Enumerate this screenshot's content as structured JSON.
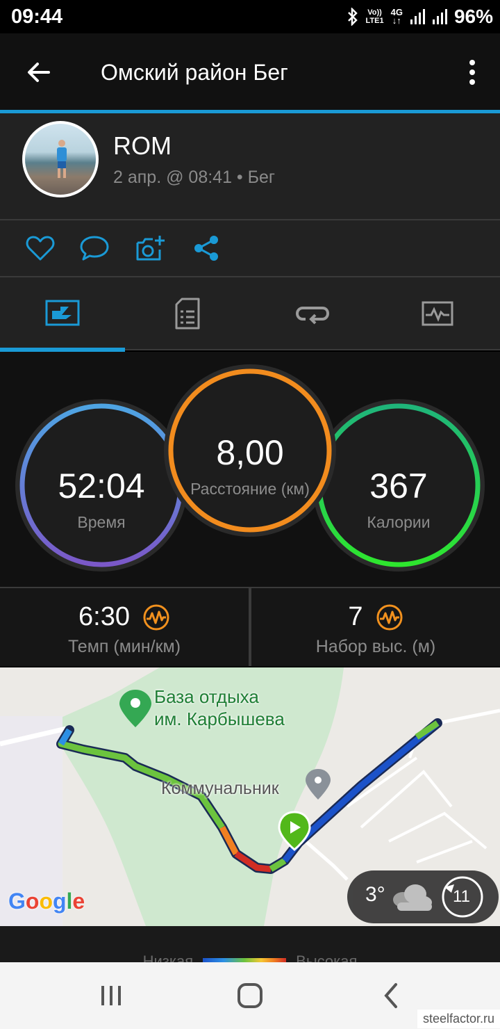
{
  "status_bar": {
    "time": "09:44",
    "network_line1": "Vo))",
    "network_line2": "LTE1",
    "network_type": "4G",
    "battery": "96%"
  },
  "header": {
    "title": "Омский район Бег"
  },
  "user": {
    "name": "ROM",
    "activity_info": "2 апр. @ 08:41 • Бег"
  },
  "summary": {
    "time_value": "52:04",
    "time_label": "Время",
    "distance_value": "8,00",
    "distance_label": "Расстояние (км)",
    "calories_value": "367",
    "calories_label": "Калории"
  },
  "metrics": {
    "pace_value": "6:30",
    "pace_label": "Темп (мин/км)",
    "elevation_value": "7",
    "elevation_label": "Набор выс. (м)"
  },
  "map": {
    "poi_name_line1": "База отдыха",
    "poi_name_line2": "им. Карбышева",
    "place_label": "Коммунальник",
    "google_logo": "Google",
    "weather_temp": "3°",
    "weather_wind": "11"
  },
  "legend": {
    "low_label": "Низкая",
    "high_label": "Высокая"
  },
  "watermark": "steelfactor.ru",
  "colors": {
    "accent": "#1a9ad6",
    "time_ring": "#5b6fd6",
    "distance_ring": "#f28c1e",
    "calories_ring": "#1ed760"
  }
}
